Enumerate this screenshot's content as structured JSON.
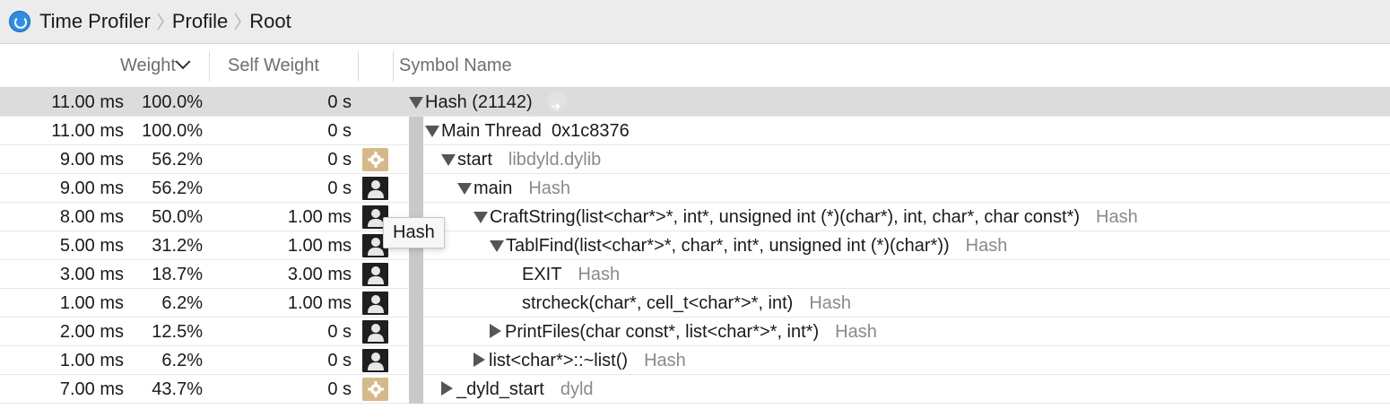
{
  "breadcrumb": {
    "items": [
      "Time Profiler",
      "Profile",
      "Root"
    ]
  },
  "columns": {
    "weight": "Weight",
    "self_weight": "Self Weight",
    "symbol_name": "Symbol Name"
  },
  "rows": [
    {
      "weight_ms": "11.00 ms",
      "weight_pct": "100.0%",
      "self": "0 s",
      "icon": "none",
      "disclosure": "expanded",
      "symbol": "Hash (21142)",
      "library": ""
    },
    {
      "weight_ms": "11.00 ms",
      "weight_pct": "100.0%",
      "self": "0 s",
      "icon": "none",
      "disclosure": "expanded",
      "symbol": "Main Thread  0x1c8376",
      "library": ""
    },
    {
      "weight_ms": "9.00 ms",
      "weight_pct": "56.2%",
      "self": "0 s",
      "icon": "gear-icon",
      "disclosure": "expanded",
      "symbol": "start",
      "library": "libdyld.dylib"
    },
    {
      "weight_ms": "9.00 ms",
      "weight_pct": "56.2%",
      "self": "0 s",
      "icon": "user-icon",
      "disclosure": "expanded",
      "symbol": "main",
      "library": "Hash"
    },
    {
      "weight_ms": "8.00 ms",
      "weight_pct": "50.0%",
      "self": "1.00 ms",
      "icon": "user-icon",
      "disclosure": "expanded",
      "symbol": "CraftString(list<char*>*, int*, unsigned int (*)(char*), int, char*, char const*)",
      "library": "Hash"
    },
    {
      "weight_ms": "5.00 ms",
      "weight_pct": "31.2%",
      "self": "1.00 ms",
      "icon": "user-icon",
      "disclosure": "expanded",
      "symbol": "TablFind(list<char*>*, char*, int*, unsigned int (*)(char*))",
      "library": "Hash"
    },
    {
      "weight_ms": "3.00 ms",
      "weight_pct": "18.7%",
      "self": "3.00 ms",
      "icon": "user-icon",
      "disclosure": "none",
      "symbol": "EXIT",
      "library": "Hash"
    },
    {
      "weight_ms": "1.00 ms",
      "weight_pct": "6.2%",
      "self": "1.00 ms",
      "icon": "user-icon",
      "disclosure": "none",
      "symbol": "strcheck(char*, cell_t<char*>*, int)",
      "library": "Hash"
    },
    {
      "weight_ms": "2.00 ms",
      "weight_pct": "12.5%",
      "self": "0 s",
      "icon": "user-icon",
      "disclosure": "collapsed",
      "symbol": "PrintFiles(char const*, list<char*>*, int*)",
      "library": "Hash"
    },
    {
      "weight_ms": "1.00 ms",
      "weight_pct": "6.2%",
      "self": "0 s",
      "icon": "user-icon",
      "disclosure": "collapsed",
      "symbol": "list<char*>::~list()",
      "library": "Hash"
    },
    {
      "weight_ms": "7.00 ms",
      "weight_pct": "43.7%",
      "self": "0 s",
      "icon": "gear-icon",
      "disclosure": "collapsed",
      "symbol": "_dyld_start",
      "library": "dyld"
    }
  ],
  "tooltip": {
    "text": "Hash"
  }
}
